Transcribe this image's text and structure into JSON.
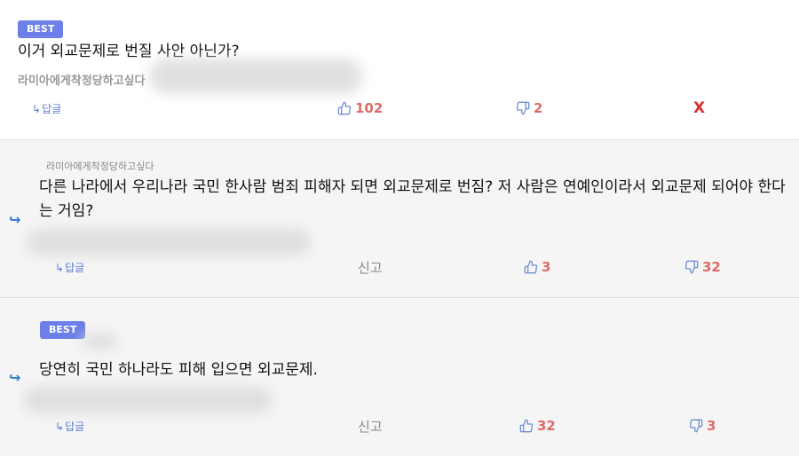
{
  "comments": [
    {
      "badge": "BEST",
      "text": "이거 외교문제로 번질 사안 아닌가?",
      "author": "라미아에게착정당하고싶다",
      "reply_label": "답글",
      "likes": "102",
      "dislikes": "2",
      "delete_label": "X"
    },
    {
      "author": "라미아에게착정당하고싶다",
      "text_line1": "다른 나라에서 우리나라 국민 한사람 범죄 피해자 되면 외교문제로 번짐? 저 사람은 연예인이라서 외교문제 되어야 한다",
      "text_line2": "는 거임?",
      "reply_label": "답글",
      "report_label": "신고",
      "likes": "3",
      "dislikes": "32"
    },
    {
      "badge": "BEST",
      "text": "당연히 국민 하나라도 피해 입으면 외교문제.",
      "reply_label": "답글",
      "report_label": "신고",
      "likes": "32",
      "dislikes": "3"
    }
  ],
  "colors": {
    "badge": "#6d7fe8",
    "count": "#e06a6a",
    "thumb": "#6f8fd6",
    "delete": "#d62f2f",
    "reply_arrow": "#2b7bd6"
  },
  "icons": {
    "like": "thumbs-up-icon",
    "dislike": "thumbs-down-icon",
    "reply": "reply-arrow-icon"
  }
}
